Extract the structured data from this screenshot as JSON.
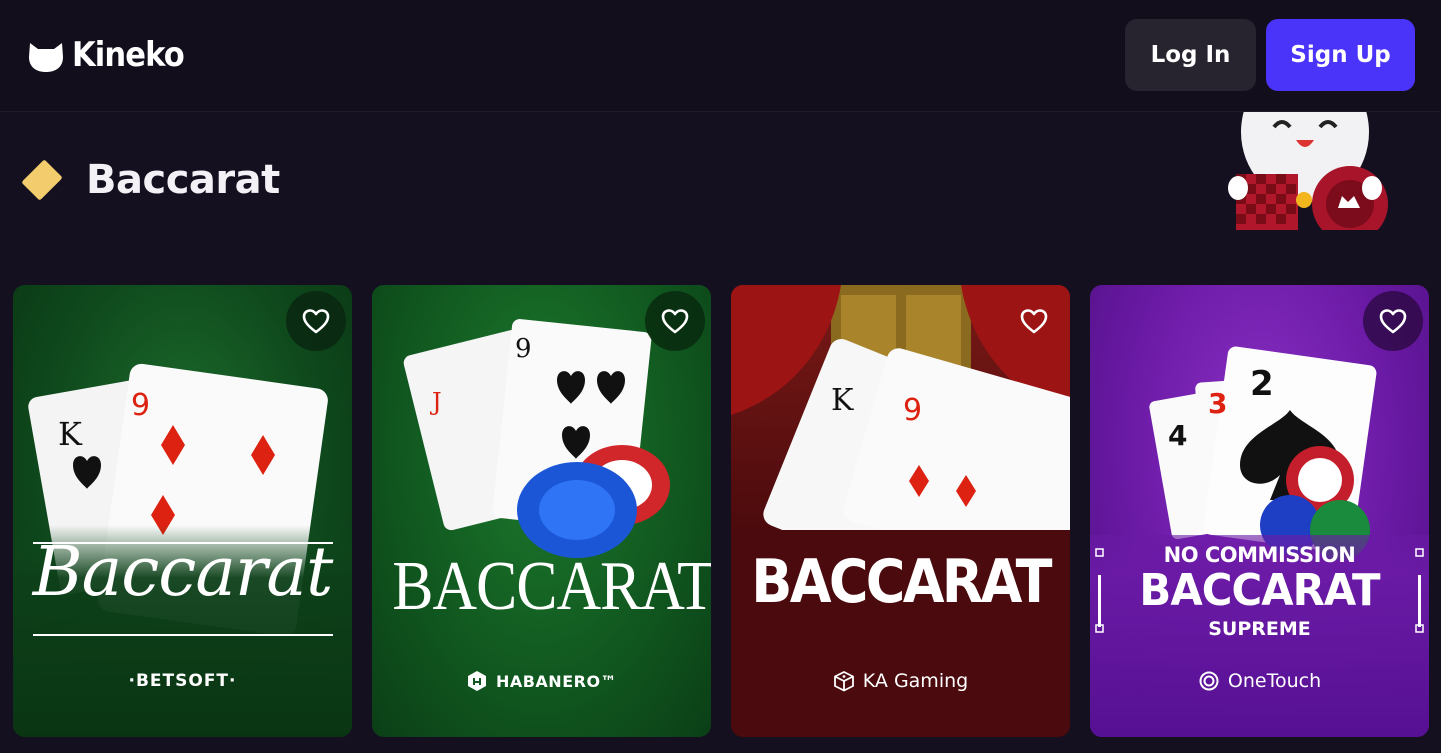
{
  "header": {
    "logo_text": "Kineko",
    "login_label": "Log In",
    "signup_label": "Sign Up"
  },
  "section": {
    "title": "Baccarat",
    "icon": "diamond-icon"
  },
  "games": [
    {
      "title": "Baccarat",
      "provider": "·BETSOFT·",
      "favorite_icon": "heart-icon"
    },
    {
      "title": "BACCARAT",
      "provider": "HABANERO™",
      "favorite_icon": "heart-icon"
    },
    {
      "title": "BACCARAT",
      "provider": "KA Gaming",
      "favorite_icon": "heart-icon"
    },
    {
      "title_top": "NO COMMISSION",
      "title": "BACCARAT",
      "title_bottom": "SUPREME",
      "provider": "OneTouch",
      "favorite_icon": "heart-icon"
    }
  ],
  "colors": {
    "background": "#14101f",
    "signup": "#4b34fa",
    "login": "#27232f",
    "accent_diamond": "#f3cd6d"
  }
}
